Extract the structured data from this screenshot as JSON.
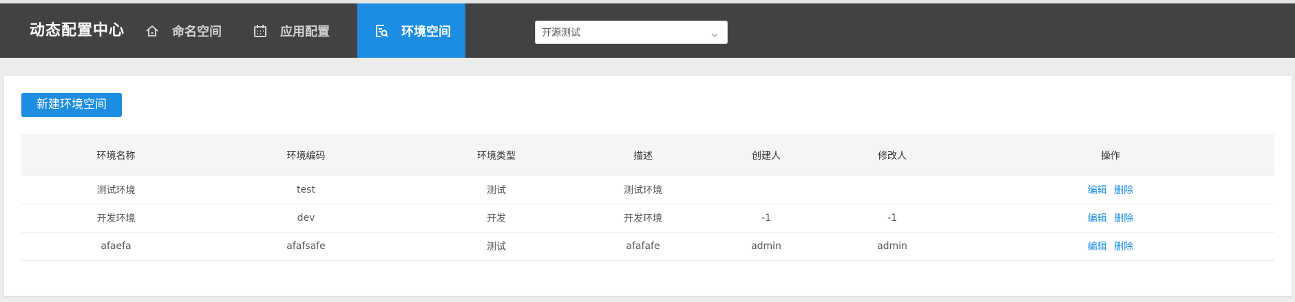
{
  "header": {
    "brand": "动态配置中心",
    "nav": [
      {
        "label": "命名空间",
        "icon": "home-icon"
      },
      {
        "label": "应用配置",
        "icon": "calendar-icon"
      },
      {
        "label": "环境空间",
        "icon": "search-document-icon",
        "active": true
      }
    ],
    "namespace_select": {
      "value": "开源测试",
      "icon": "chevron-down-icon"
    }
  },
  "main": {
    "new_button": "新建环境空间",
    "table": {
      "columns": [
        "环境名称",
        "环境编码",
        "环境类型",
        "描述",
        "创建人",
        "修改人",
        "操作"
      ],
      "rows": [
        {
          "name": "测试环境",
          "code": "test",
          "type": "测试",
          "desc": "测试环境",
          "creator": "",
          "modifier": "",
          "edit": "编辑",
          "delete": "删除"
        },
        {
          "name": "开发环境",
          "code": "dev",
          "type": "开发",
          "desc": "开发环境",
          "creator": "-1",
          "modifier": "-1",
          "edit": "编辑",
          "delete": "删除"
        },
        {
          "name": "afaefa",
          "code": "afafsafe",
          "type": "测试",
          "desc": "afafafe",
          "creator": "admin",
          "modifier": "admin",
          "edit": "编辑",
          "delete": "删除"
        }
      ]
    }
  },
  "colors": {
    "navbar": "#424242",
    "accent": "#1c8de0",
    "background": "#ececec"
  }
}
